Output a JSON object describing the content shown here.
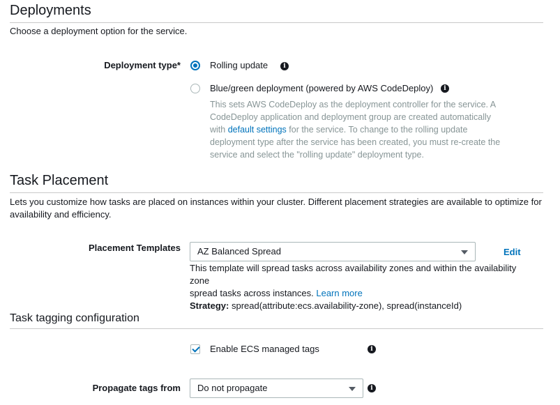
{
  "deployments": {
    "title": "Deployments",
    "description": "Choose a deployment option for the service.",
    "type_label": "Deployment type*",
    "options": [
      {
        "label": "Rolling update",
        "selected": true
      },
      {
        "label": "Blue/green deployment (powered by AWS CodeDeploy)",
        "selected": false
      }
    ],
    "bluegreen_help": {
      "line1": "This sets AWS CodeDeploy as the deployment controller for the service. A",
      "line2": "CodeDeploy application and deployment group are created automatically",
      "line3_pre": "with ",
      "line3_link": "default settings",
      "line3_post": " for the service. To change to the rolling update",
      "line4": "deployment type after the service has been created, you must re-create the",
      "line5": "service and select the \"rolling update\" deployment type."
    }
  },
  "task_placement": {
    "title": "Task Placement",
    "description_line1": "Lets you customize how tasks are placed on instances within your cluster. Different placement strategies are available to optimize for",
    "description_line2": "availability and efficiency.",
    "templates_label": "Placement Templates",
    "template_value": "AZ Balanced Spread",
    "edit_label": "Edit",
    "help_line1": "This template will spread tasks across availability zones and within the availability zone",
    "help_line2": "spread tasks across instances. ",
    "learn_more": "Learn more",
    "strategy_label": "Strategy:",
    "strategy_value": " spread(attribute:ecs.availability-zone), spread(instanceId)"
  },
  "task_tagging": {
    "title": "Task tagging configuration",
    "managed_tags_label": "Enable ECS managed tags",
    "managed_tags_checked": true,
    "propagate_label": "Propagate tags from",
    "propagate_value": "Do not propagate"
  },
  "icons": {
    "info": "info-icon",
    "caret": "caret-down-icon",
    "check": "check-icon"
  },
  "colors": {
    "accent": "#0073bb",
    "muted_text": "#879596",
    "border": "#aab7b8"
  }
}
